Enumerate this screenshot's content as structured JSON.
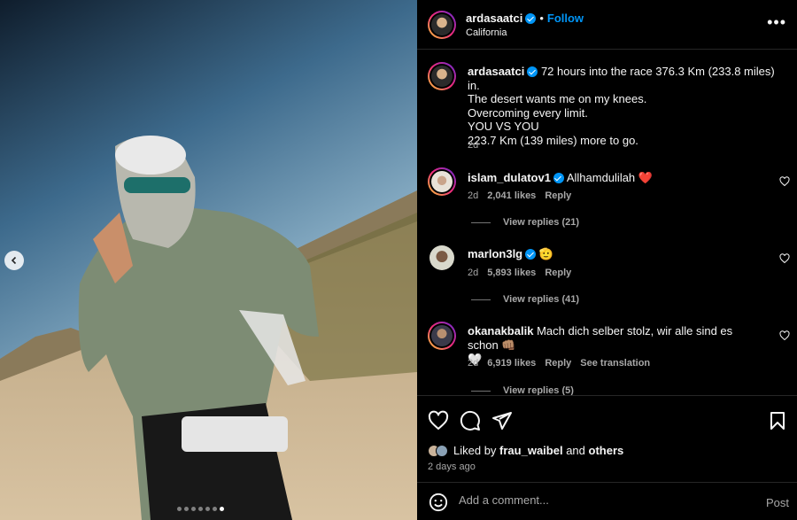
{
  "header": {
    "username": "ardasaatci",
    "separator": "•",
    "follow_label": "Follow",
    "location": "California",
    "more_icon": "more-horizontal-icon"
  },
  "caption": {
    "username": "ardasaatci",
    "lines": [
      "72 hours into the race 376.3 Km (233.8 miles) in.",
      "The desert wants me on my knees.",
      "Overcoming every limit.",
      "YOU VS YOU",
      "223.7 Km (139 miles) more to go."
    ],
    "time": "2d"
  },
  "comments": [
    {
      "username": "islam_dulatov1",
      "text": "Allhamdulilah",
      "emoji": "❤️",
      "time": "2d",
      "likes": "2,041 likes",
      "reply": "Reply",
      "view_replies": "View replies (21)"
    },
    {
      "username": "marlon3lg",
      "text": "",
      "emoji": "🫡",
      "time": "2d",
      "likes": "5,893 likes",
      "reply": "Reply",
      "view_replies": "View replies (41)"
    },
    {
      "username": "okanakbalik",
      "text": "Mach dich selber stolz, wir alle sind es schon",
      "emoji": "👊🏽",
      "emoji2": "🤍",
      "time": "2d",
      "likes": "6,919 likes",
      "reply": "Reply",
      "translate": "See translation",
      "view_replies": "View replies (5)"
    }
  ],
  "actions": {
    "liked_prefix": "Liked by",
    "liked_user": "frau_waibel",
    "liked_and": "and",
    "liked_others": "others",
    "date": "2 days ago"
  },
  "composer": {
    "placeholder": "Add a comment...",
    "post_label": "Post"
  },
  "carousel": {
    "total": 7,
    "active_index": 6
  },
  "colors": {
    "accent": "#0095f6",
    "like_red": "#ff3040",
    "muted": "#a8a8a8"
  }
}
